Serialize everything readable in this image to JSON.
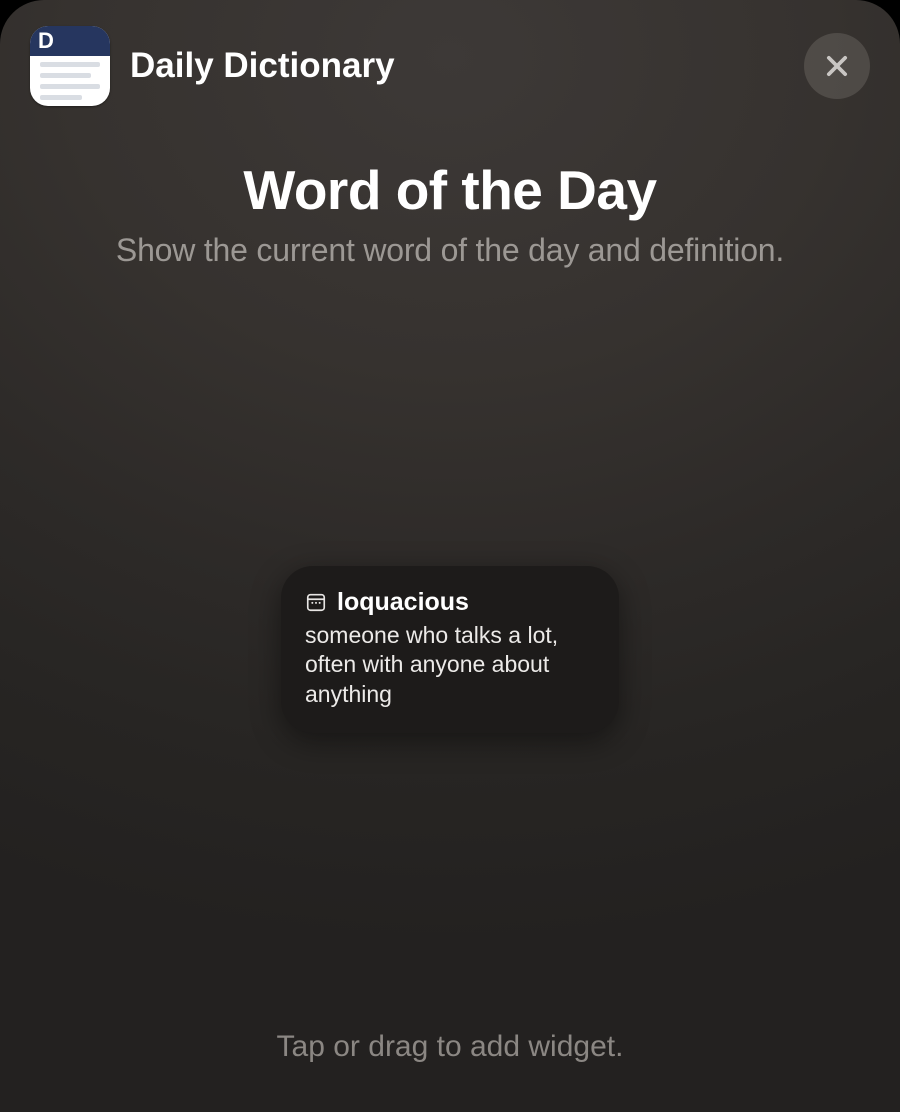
{
  "header": {
    "app_name": "Daily Dictionary",
    "app_icon_letter": "D"
  },
  "title": "Word of the Day",
  "subtitle": "Show the current word of the day and definition.",
  "widget": {
    "word": "loquacious",
    "definition": "someone who talks a lot, often with anyone about anything"
  },
  "footer_hint": "Tap or drag to add widget."
}
